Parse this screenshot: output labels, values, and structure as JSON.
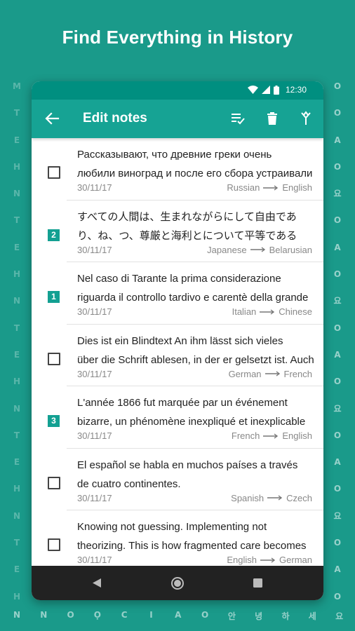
{
  "headline": "Find Everything in History",
  "background_letters": {
    "left_column": [
      "M",
      "T",
      "E",
      "H",
      "N",
      "T",
      "E",
      "H",
      "N",
      "T",
      "E",
      "H",
      "N",
      "T",
      "E",
      "H",
      "N",
      "T",
      "E",
      "H"
    ],
    "right_column": [
      "O",
      "O",
      "A",
      "O",
      "요",
      "O",
      "A",
      "O",
      "요",
      "O",
      "A",
      "O",
      "요",
      "O",
      "A",
      "O",
      "요",
      "O",
      "A",
      "O"
    ],
    "bottom_row": [
      "N",
      "N",
      "O",
      "Ọ",
      "C",
      "I",
      "A",
      "O",
      "안",
      "녕",
      "하",
      "세",
      "요"
    ]
  },
  "status_bar": {
    "time": "12:30"
  },
  "app_bar": {
    "title": "Edit notes",
    "back_icon": "arrow-left-icon",
    "actions": [
      "playlist-check-icon",
      "delete-icon",
      "merge-icon"
    ]
  },
  "notes": [
    {
      "line1": "Рассказывают, что древние греки очень",
      "line2": "любили виноград и после его сбора устраивали",
      "date": "30/11/17",
      "from": "Russian",
      "to": "English",
      "selection": null
    },
    {
      "line1": "すべての人間は、生まれながらにして自由であ",
      "line2": "り、ね、つ、尊厳と海利とについて平等である",
      "date": "30/11/17",
      "from": "Japanese",
      "to": "Belarusian",
      "selection": "2"
    },
    {
      "line1": "Nel caso di Tarante la prima considerazione",
      "line2": "riguarda il controllo tardivo e carentè della grande",
      "date": "30/11/17",
      "from": "Italian",
      "to": "Chinese",
      "selection": "1"
    },
    {
      "line1": "Dies ist ein Blindtext An ihm lässt sich vieles",
      "line2": "über die Schrift ablesen, in der er gelsetzt ist. Auch",
      "date": "30/11/17",
      "from": "German",
      "to": "French",
      "selection": null
    },
    {
      "line1": "L'année 1866 fut marquée par un événement",
      "line2": "bizarre, un phénomène inexpliqué et inexplicable",
      "date": "30/11/17",
      "from": "French",
      "to": "English",
      "selection": "3"
    },
    {
      "line1": "El español se habla en muchos países a través",
      "line2": "de cuatro continentes.",
      "date": "30/11/17",
      "from": "Spanish",
      "to": "Czech",
      "selection": null
    },
    {
      "line1": "Knowing not guessing. Implementing not",
      "line2": "theorizing. This is how fragmented care becomes",
      "date": "30/11/17",
      "from": "English",
      "to": "German",
      "selection": null
    }
  ],
  "nav_bar": [
    "back-triangle-icon",
    "home-circle-icon",
    "recents-square-icon"
  ],
  "colors": {
    "background": "#1a9a8a",
    "app_bar": "#16a394",
    "status_bar": "#008f80",
    "badge": "#13a092"
  }
}
